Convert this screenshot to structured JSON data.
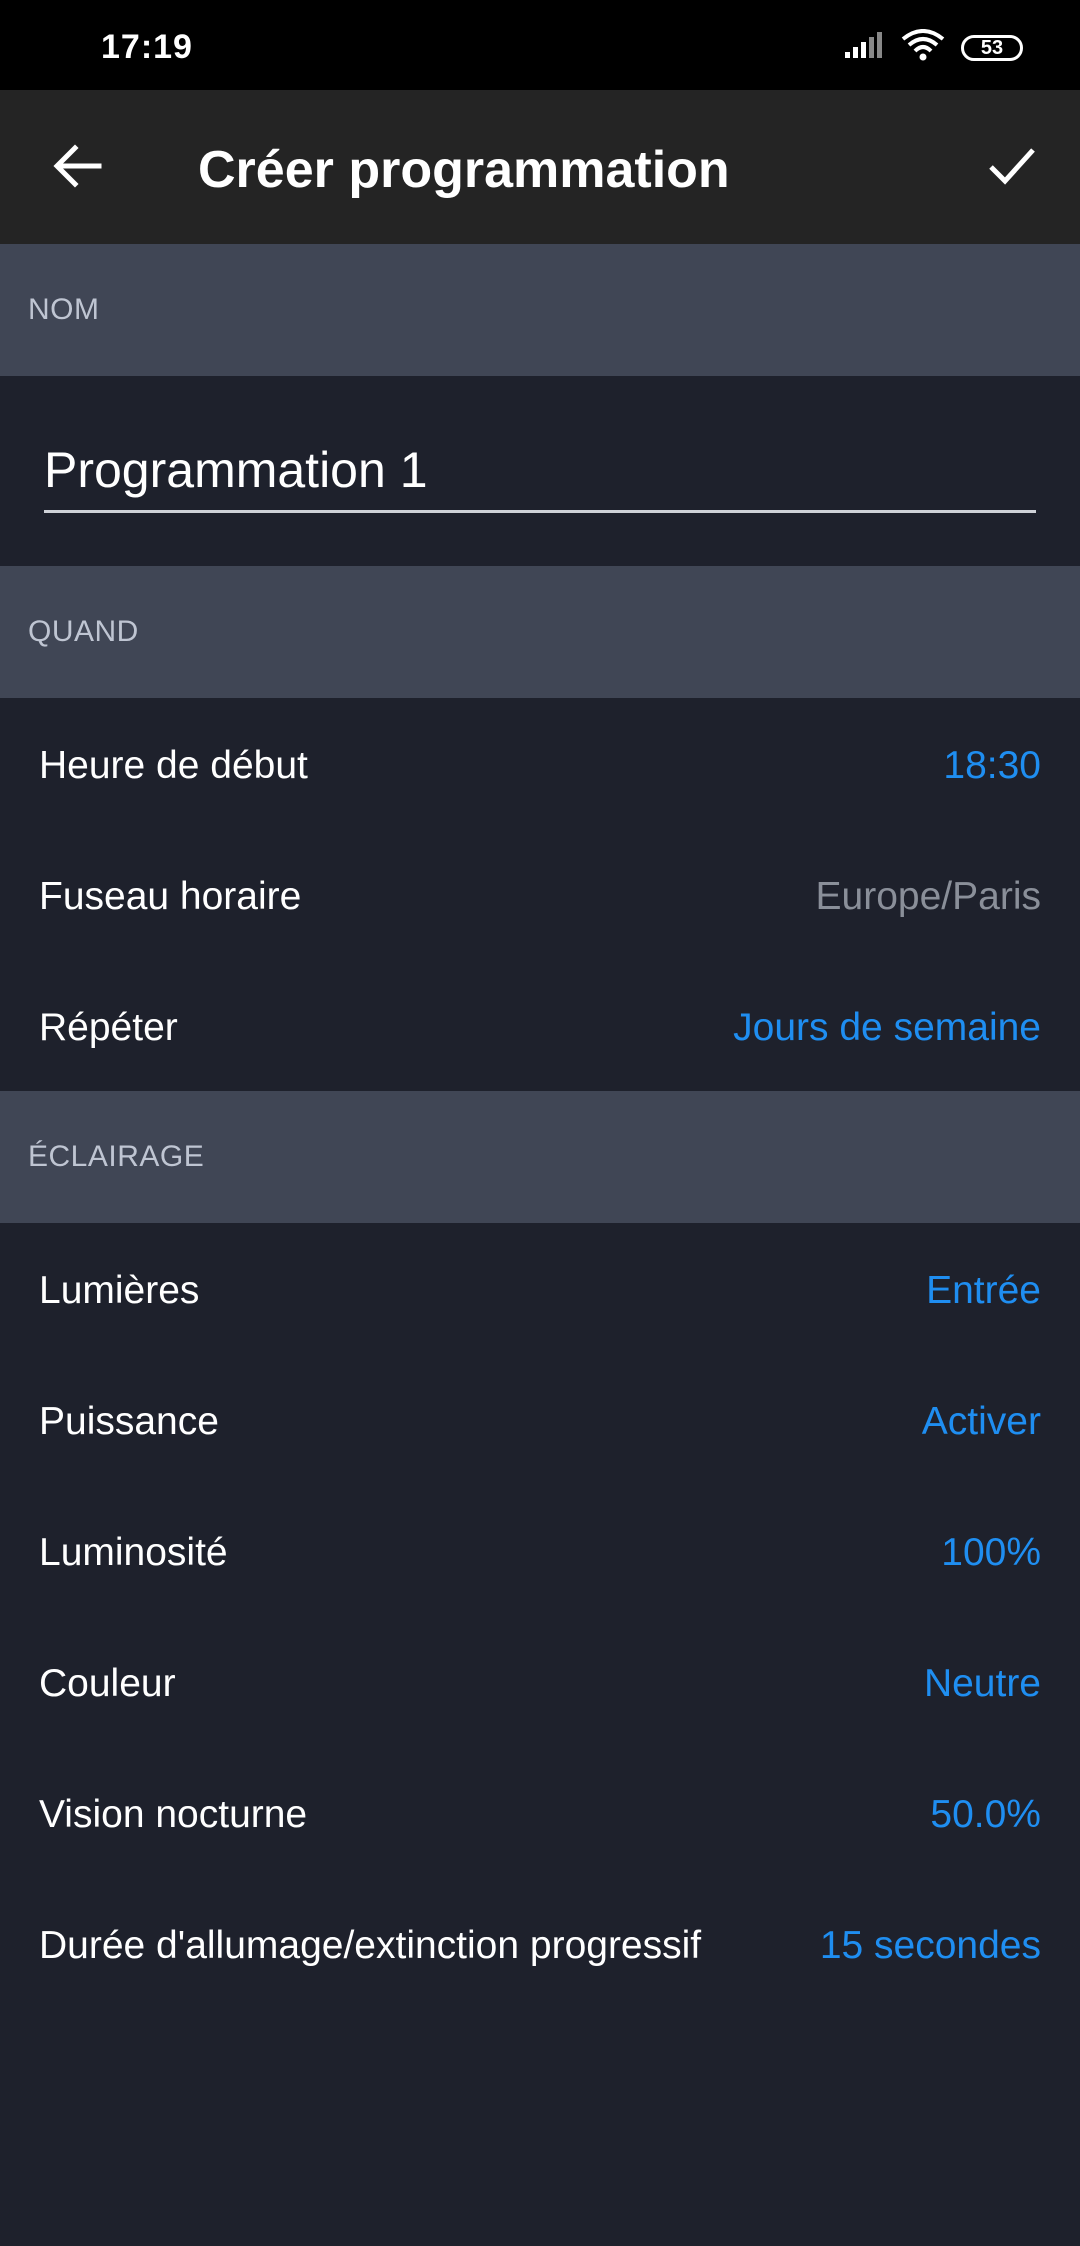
{
  "status_bar": {
    "time": "17:19",
    "battery": "53"
  },
  "toolbar": {
    "title": "Créer programmation"
  },
  "sections": {
    "name": {
      "header": "NOM",
      "value": "Programmation 1"
    },
    "when": {
      "header": "QUAND",
      "rows": [
        {
          "label": "Heure de début",
          "value": "18:30"
        },
        {
          "label": "Fuseau horaire",
          "value": "Europe/Paris"
        },
        {
          "label": "Répéter",
          "value": "Jours de semaine"
        }
      ]
    },
    "lighting": {
      "header": "ÉCLAIRAGE",
      "rows": [
        {
          "label": "Lumières",
          "value": "Entrée"
        },
        {
          "label": "Puissance",
          "value": "Activer"
        },
        {
          "label": "Luminosité",
          "value": "100%"
        },
        {
          "label": "Couleur",
          "value": "Neutre"
        },
        {
          "label": "Vision nocturne",
          "value": "50.0%"
        },
        {
          "label": "Durée d'allumage/extinction progressif",
          "value": "15 secondes"
        }
      ]
    }
  },
  "colors": {
    "accent": "#1f8ef1",
    "header_bg": "#404655",
    "background": "#1e212c",
    "toolbar": "#242424"
  },
  "icons": [
    "back-arrow-icon",
    "check-icon",
    "signal-icon",
    "wifi-icon",
    "battery-icon"
  ]
}
